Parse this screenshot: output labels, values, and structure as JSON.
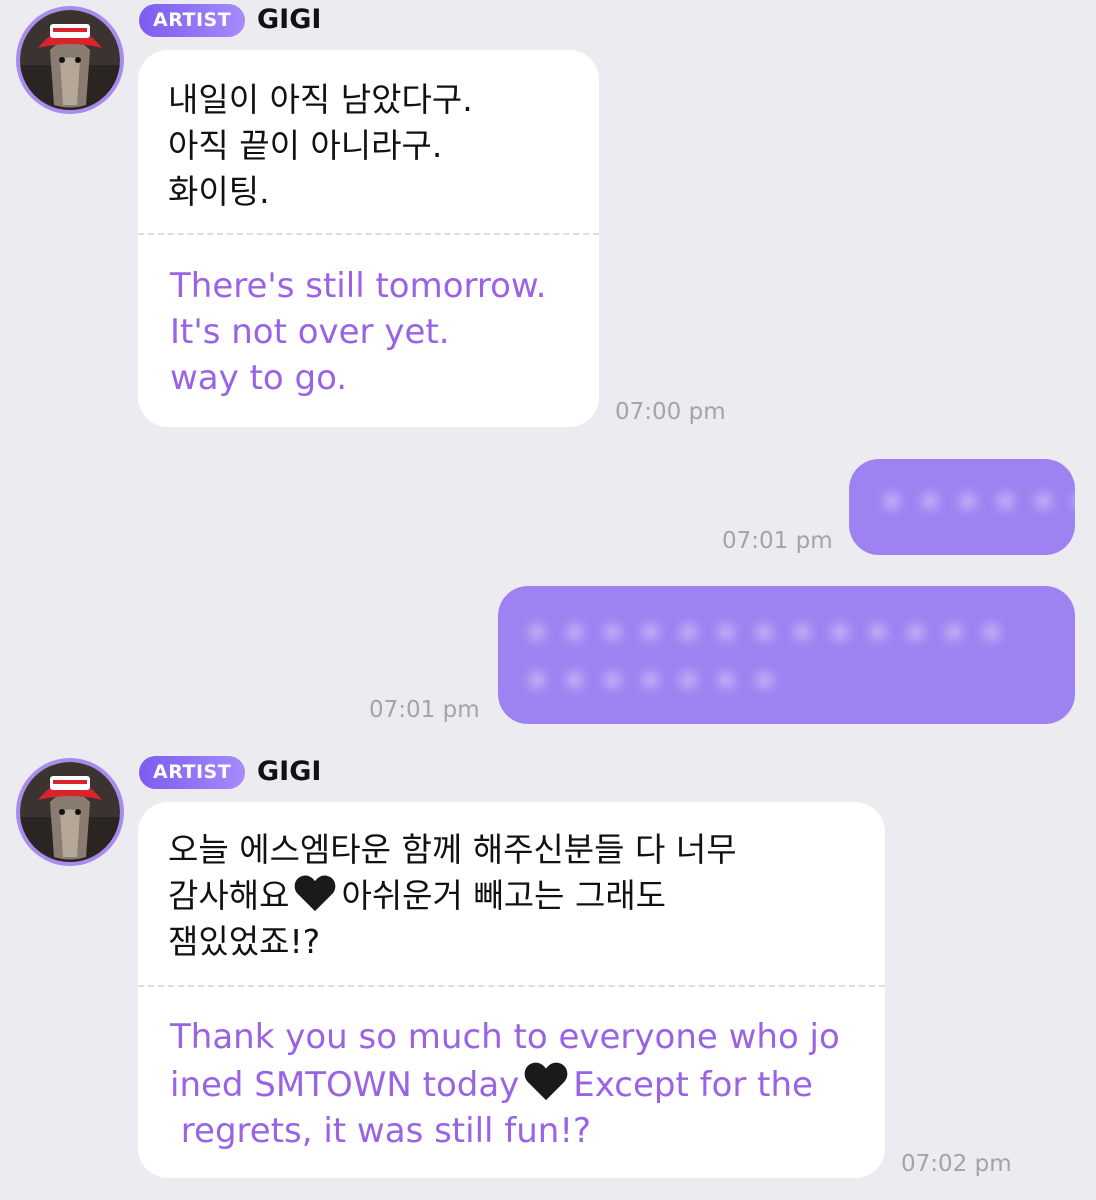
{
  "messages": [
    {
      "badge": "ARTIST",
      "sender": "GIGI",
      "korean": "내일이 아직 남았다구.\n아직 끝이 아니라구.\n화이팅.",
      "english": "There's still tomorrow.\nIt's not over yet.\nway to go.",
      "time": "07:00 pm"
    },
    {
      "time": "07:01 pm"
    },
    {
      "time": "07:01 pm"
    },
    {
      "badge": "ARTIST",
      "sender": "GIGI",
      "korean_line1": "오늘 에스엠타운 함께 해주신분들 다 너무",
      "korean_line2a": "감사해요",
      "korean_line2b": "아쉬운거 빼고는 그래도",
      "korean_line3": "잼있었죠!?",
      "english_line1": "Thank you so much to everyone who jo",
      "english_line2a": "ined SMTOWN today",
      "english_line2b": "Except for the",
      "english_line3": " regrets, it was still fun!?",
      "emoji": "black-heart-icon",
      "time": "07:02 pm"
    }
  ],
  "colors": {
    "background": "#ececf0",
    "english_text": "#9a63e6",
    "outgoing_bubble": "#9e82f2",
    "badge_gradient": [
      "#7c5cf0",
      "#a78bfa"
    ]
  }
}
